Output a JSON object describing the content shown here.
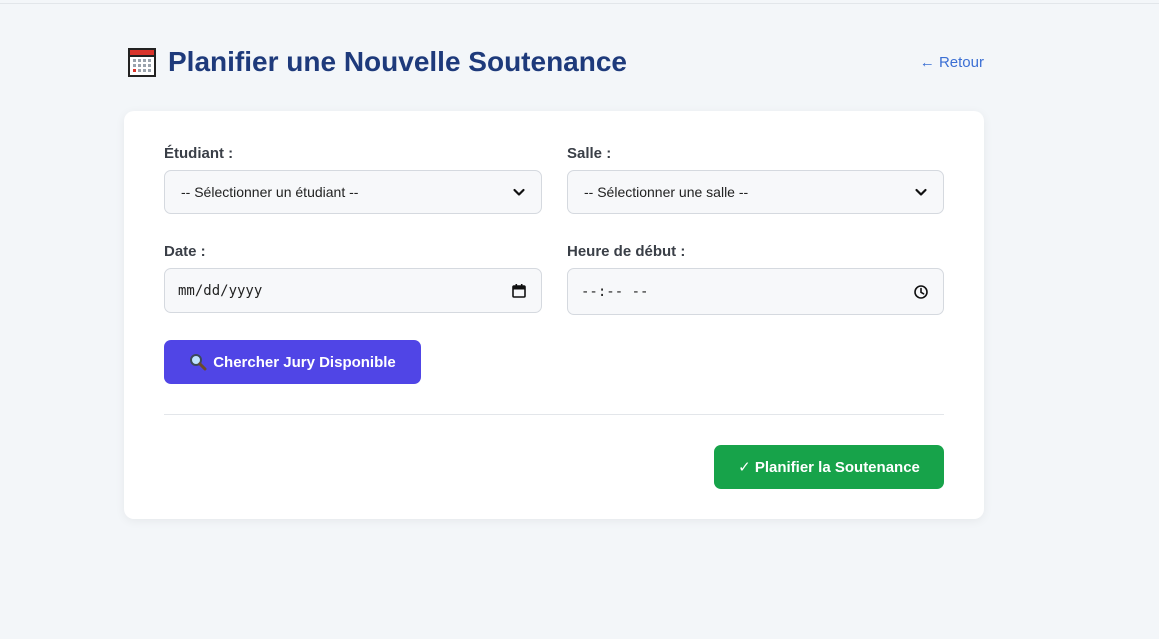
{
  "header": {
    "title": "Planifier une Nouvelle Soutenance",
    "title_icon": "calendar-icon",
    "back_link": "← Retour",
    "title_color": "#1e3a7b",
    "link_color": "#3b6fd4"
  },
  "form": {
    "student": {
      "label": "Étudiant :",
      "selected": "-- Sélectionner un étudiant --"
    },
    "room": {
      "label": "Salle :",
      "selected": "-- Sélectionner une salle --"
    },
    "date": {
      "label": "Date :",
      "placeholder": "mm/dd/yyyy",
      "icon": "calendar-picker-icon"
    },
    "start_time": {
      "label": "Heure de début :",
      "placeholder": "--:-- --",
      "icon": "clock-icon"
    }
  },
  "actions": {
    "search_jury": {
      "icon": "🔍",
      "icon_name": "magnifier-icon",
      "label": "Chercher Jury Disponible",
      "color": "#5045e6"
    },
    "submit": {
      "label": "✓ Planifier la Soutenance",
      "color": "#17a34a"
    }
  }
}
